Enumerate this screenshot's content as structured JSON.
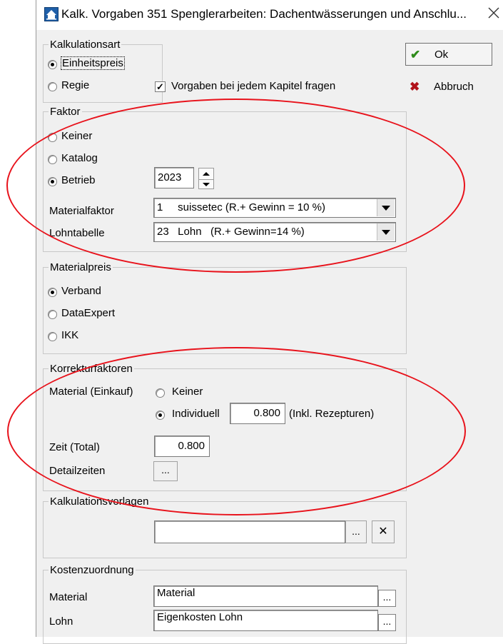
{
  "window": {
    "title": "Kalk. Vorgaben 351 Spenglerarbeiten: Dachentwässerungen und Anschlu...",
    "close_glyph": "╳",
    "icon": "app-logo-icon"
  },
  "buttons": {
    "ok_label": "Ok",
    "ok_icon": "checkmark-icon",
    "cancel_label": "Abbruch",
    "cancel_icon": "red-x-icon"
  },
  "kalkulationsart": {
    "legend": "Kalkulationsart",
    "options": [
      "Einheitspreis",
      "Regie"
    ],
    "selected": "Einheitspreis",
    "checkbox_label": "Vorgaben bei jedem Kapitel fragen",
    "checkbox_checked": true
  },
  "faktor": {
    "legend": "Faktor",
    "options": [
      "Keiner",
      "Katalog",
      "Betrieb"
    ],
    "selected": "Betrieb",
    "year": "2023",
    "materialfaktor_label": "Materialfaktor",
    "materialfaktor_value": "1     suissetec (R.+ Gewinn = 10 %)",
    "lohntabelle_label": "Lohntabelle",
    "lohntabelle_value": "23   Lohn   (R.+ Gewinn=14 %)"
  },
  "materialpreis": {
    "legend": "Materialpreis",
    "options": [
      "Verband",
      "DataExpert",
      "IKK"
    ],
    "selected": "Verband"
  },
  "korrekturfaktoren": {
    "legend": "Korrekturfaktoren",
    "material_label": "Material (Einkauf)",
    "option_keiner": "Keiner",
    "option_individuell": "Individuell",
    "selected": "Individuell",
    "material_value": "0.800",
    "material_note": "(Inkl. Rezepturen)",
    "zeit_label": "Zeit (Total)",
    "zeit_value": "0.800",
    "detailzeiten_label": "Detailzeiten",
    "detailzeiten_button": "..."
  },
  "kalkulationsvorlagen": {
    "legend": "Kalkulationsvorlagen",
    "value": "",
    "browse_button": "...",
    "clear_button": "✕"
  },
  "kostenzuordnung": {
    "legend": "Kostenzuordnung",
    "material_label": "Material",
    "material_value": "Material",
    "lohn_label": "Lohn",
    "lohn_value": "Eigenkosten Lohn",
    "browse_button": "..."
  },
  "annotation_color": "#e8121b"
}
